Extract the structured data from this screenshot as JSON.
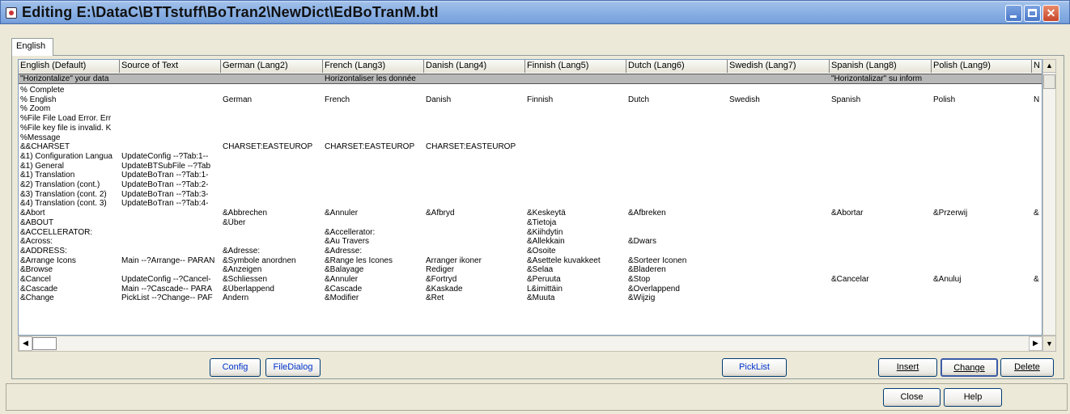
{
  "window": {
    "title": "Editing E:\\DataC\\BTTstuff\\BoTran2\\NewDict\\EdBoTranM.btl"
  },
  "tabs": [
    {
      "label": "English"
    }
  ],
  "grid": {
    "columns": [
      "English (Default)",
      "Source of Text",
      "German (Lang2)",
      "French (Lang3)",
      "Danish (Lang4)",
      "Finnish (Lang5)",
      "Dutch (Lang6)",
      "Swedish (Lang7)",
      "Spanish (Lang8)",
      "Polish (Lang9)",
      "N"
    ],
    "rows": [
      [
        "\"Horizontalize\" your data",
        "",
        "",
        "Horizontaliser les donnée",
        "",
        "",
        "",
        "",
        "\"Horizontalizar\" su inform",
        "",
        ""
      ],
      [
        "% Complete",
        "",
        "",
        "",
        "",
        "",
        "",
        "",
        "",
        "",
        ""
      ],
      [
        "% English",
        "",
        "German",
        "French",
        "Danish",
        "Finnish",
        "Dutch",
        "Swedish",
        "Spanish",
        "Polish",
        "N"
      ],
      [
        "% Zoom",
        "",
        "",
        "",
        "",
        "",
        "",
        "",
        "",
        "",
        ""
      ],
      [
        "%File File Load Error.  Err",
        "",
        "",
        "",
        "",
        "",
        "",
        "",
        "",
        "",
        ""
      ],
      [
        "%File key file is invalid. K",
        "",
        "",
        "",
        "",
        "",
        "",
        "",
        "",
        "",
        ""
      ],
      [
        "%Message",
        "",
        "",
        "",
        "",
        "",
        "",
        "",
        "",
        "",
        ""
      ],
      [
        "&&CHARSET",
        "",
        "CHARSET:EASTEUROP",
        "CHARSET:EASTEUROP",
        "CHARSET:EASTEUROP",
        "",
        "",
        "",
        "",
        "",
        ""
      ],
      [
        "&1) Configuration Langua",
        "UpdateConfig --?Tab:1--",
        "",
        "",
        "",
        "",
        "",
        "",
        "",
        "",
        ""
      ],
      [
        "&1) General",
        "UpdateBTSubFile --?Tab",
        "",
        "",
        "",
        "",
        "",
        "",
        "",
        "",
        ""
      ],
      [
        "&1) Translation",
        "UpdateBoTran --?Tab:1-",
        "",
        "",
        "",
        "",
        "",
        "",
        "",
        "",
        ""
      ],
      [
        "&2) Translation (cont.)",
        "UpdateBoTran --?Tab:2-",
        "",
        "",
        "",
        "",
        "",
        "",
        "",
        "",
        ""
      ],
      [
        "&3) Translation (cont. 2)",
        "UpdateBoTran --?Tab:3-",
        "",
        "",
        "",
        "",
        "",
        "",
        "",
        "",
        ""
      ],
      [
        "&4) Translation (cont. 3)",
        "UpdateBoTran --?Tab:4-",
        "",
        "",
        "",
        "",
        "",
        "",
        "",
        "",
        ""
      ],
      [
        "&Abort",
        "",
        "&Abbrechen",
        "&Annuler",
        "&Afbryd",
        "&Keskeytä",
        "&Afbreken",
        "",
        "&Abortar",
        "&Przerwij",
        "&"
      ],
      [
        "&ABOUT",
        "",
        "&Über",
        "",
        "",
        "&Tietoja",
        "",
        "",
        "",
        "",
        ""
      ],
      [
        "&ACCELLERATOR:",
        "",
        "",
        "&Accellerator:",
        "",
        "&Kiihdytin",
        "",
        "",
        "",
        "",
        ""
      ],
      [
        "&Across:",
        "",
        "",
        "&Au Travers",
        "",
        "&Allekkain",
        "&Dwars",
        "",
        "",
        "",
        ""
      ],
      [
        "&ADDRESS:",
        "",
        "&Adresse:",
        "&Adresse:",
        "",
        "&Osoite",
        "",
        "",
        "",
        "",
        ""
      ],
      [
        "&Arrange Icons",
        "Main --?Arrange-- PARAN",
        "&Symbole anordnen",
        "&Range les Icones",
        "Arranger ikoner",
        "&Asettele kuvakkeet",
        "&Sorteer Iconen",
        "",
        "",
        "",
        ""
      ],
      [
        "&Browse",
        "",
        "&Anzeigen",
        "&Balayage",
        "Rediger",
        "&Selaa",
        "&Bladeren",
        "",
        "",
        "",
        ""
      ],
      [
        "&Cancel",
        "UpdateConfig --?Cancel-",
        "&Schliessen",
        "&Annuler",
        "&Fortryd",
        "&Peruuta",
        "&Stop",
        "",
        "&Cancelar",
        "&Anuluj",
        "&"
      ],
      [
        "&Cascade",
        "Main --?Cascade-- PARA",
        "&Überlappend",
        "&Cascade",
        "&Kaskade",
        "L&imittäin",
        "&Overlappend",
        "",
        "",
        "",
        ""
      ],
      [
        "&Change",
        "PickList --?Change-- PAF",
        "Ändern",
        "&Modifier",
        "&Ret",
        "&Muuta",
        "&Wijzig",
        "",
        "",
        "",
        ""
      ]
    ]
  },
  "buttons": {
    "config": "Config",
    "filedialog": "FileDialog",
    "picklist": "PickList",
    "insert": "Insert",
    "change": "Change",
    "delete": "Delete",
    "close": "Close",
    "help": "Help"
  },
  "icons": {
    "scroll_up": "▲",
    "scroll_down": "▼",
    "scroll_left": "◀",
    "scroll_right": "▶",
    "close_x": "✕"
  }
}
